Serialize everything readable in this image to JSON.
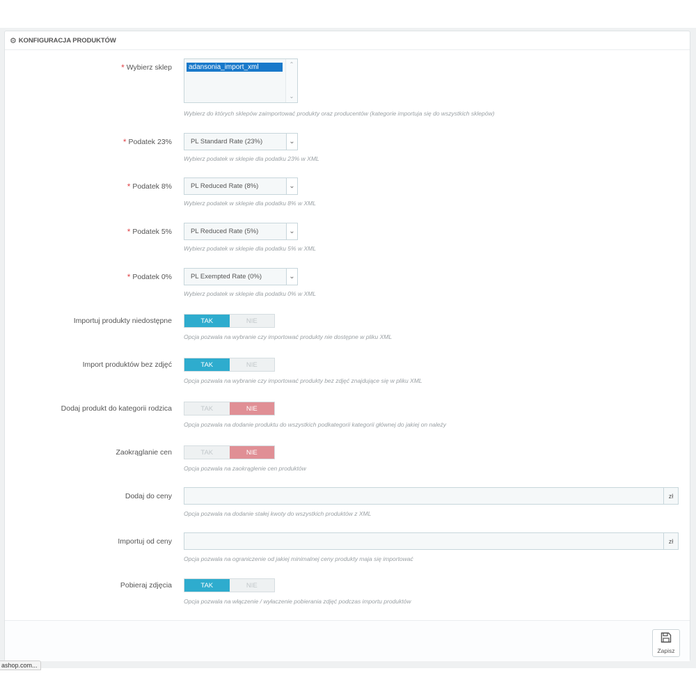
{
  "panel": {
    "icon": "cogs-icon",
    "title": "KONFIGURACJA PRODUKTÓW"
  },
  "shop": {
    "label": "Wybierz sklep",
    "selected": "adansonia_import_xml",
    "help": "Wybierz do których sklepów zaimportować produkty oraz producentów (kategorie importuja się do wszystkich sklepów)"
  },
  "tax23": {
    "label": "Podatek 23%",
    "value": "PL Standard Rate (23%)",
    "help": "Wybierz podatek w sklepie dla podatku 23% w XML"
  },
  "tax8": {
    "label": "Podatek 8%",
    "value": "PL Reduced Rate (8%)",
    "help": "Wybierz podatek w sklepie dla podatku 8% w XML"
  },
  "tax5": {
    "label": "Podatek 5%",
    "value": "PL Reduced Rate (5%)",
    "help": "Wybierz podatek w sklepie dla podatku 5% w XML"
  },
  "tax0": {
    "label": "Podatek 0%",
    "value": "PL Exempted Rate (0%)",
    "help": "Wybierz podatek w sklepie dla podatku 0% w XML"
  },
  "switches": {
    "yes": "TAK",
    "no": "NIE"
  },
  "unavailable": {
    "label": "Importuj produkty niedostępne",
    "value": true,
    "help": "Opcja pozwala na wybranie czy importować produkty nie dostępne w pliku XML"
  },
  "no_images": {
    "label": "Import produktów bez zdjęć",
    "value": true,
    "help": "Opcja pozwala na wybranie czy importować produkty bez zdjęć znajdujące się w pliku XML"
  },
  "parent_category": {
    "label": "Dodaj produkt do kategorii rodzica",
    "value": false,
    "help": "Opcja pozwala na dodanie produktu do wszystkich podkategorii kategorii głównej do jakiej on należy"
  },
  "rounding": {
    "label": "Zaokrąglanie cen",
    "value": false,
    "help": "Opcja pozwala na zaokrąglenie cen produktów"
  },
  "add_price": {
    "label": "Dodaj do ceny",
    "value": "",
    "unit": "zł",
    "help": "Opcja pozwala na dodanie stałej kwoty do wszystkich produktów z XML"
  },
  "min_price": {
    "label": "Importuj od ceny",
    "value": "",
    "unit": "zł",
    "help": "Opcja pozwala na ograniczenie od jakiej minimalnej ceny produkty maja się importować"
  },
  "fetch_images": {
    "label": "Pobieraj zdjęcia",
    "value": true,
    "help": "Opcja pozwala na włączenie / wyłaczenie pobierania zdjęć podczas importu produktów"
  },
  "footer": {
    "save_label": "Zapisz"
  },
  "status_bar": {
    "text": "ashop.com..."
  },
  "colors": {
    "accent_on": "#2eacce",
    "accent_off": "#e08f95",
    "required": "#e0464a",
    "selection": "#1979ca"
  }
}
